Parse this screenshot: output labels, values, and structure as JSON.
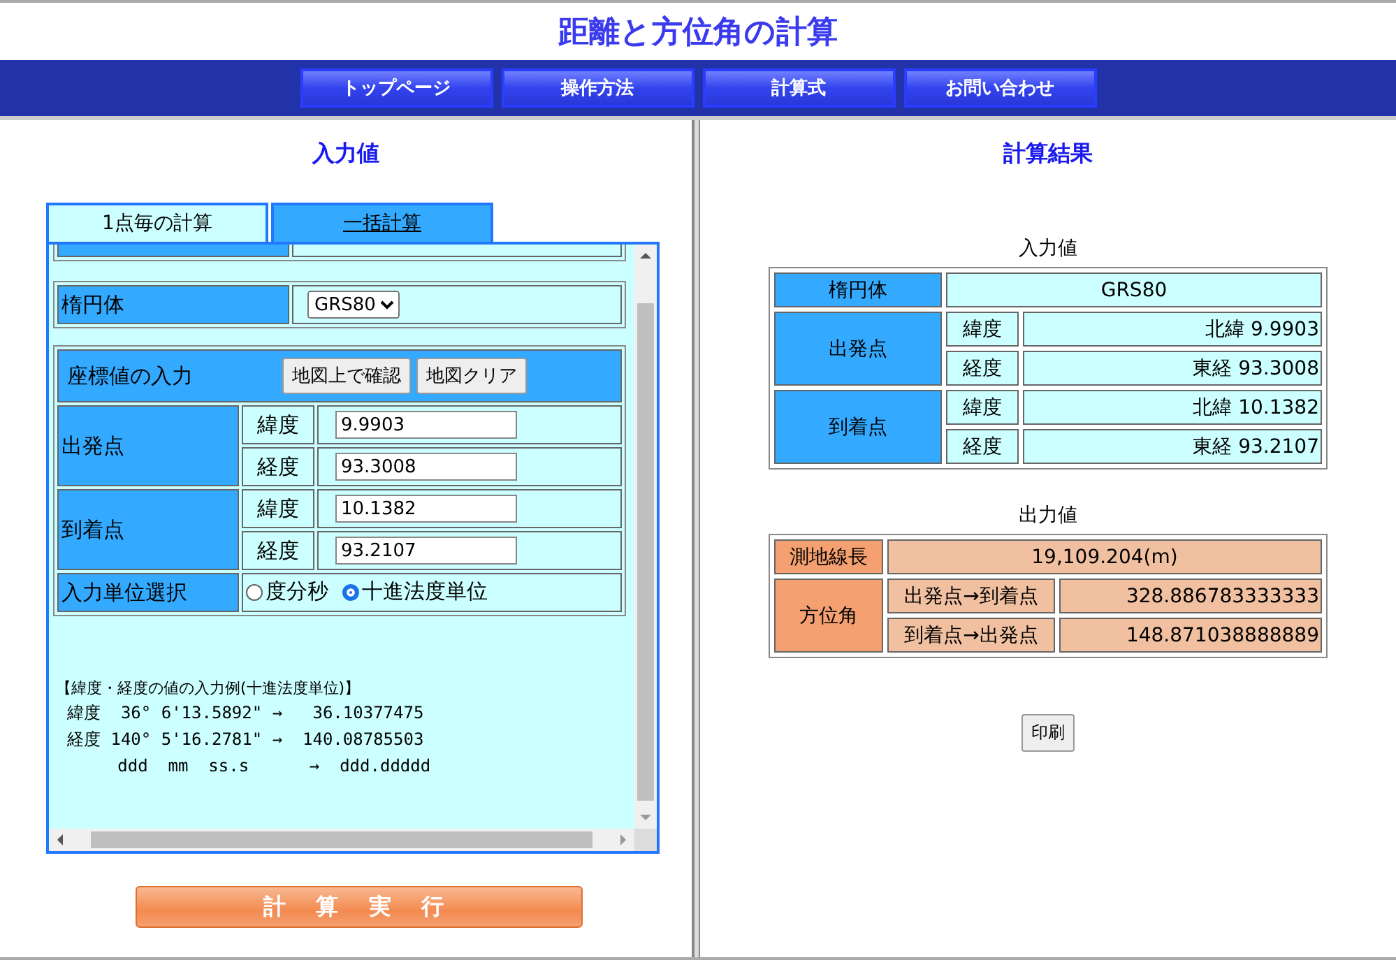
{
  "page_title": "距離と方位角の計算",
  "nav": [
    "トップページ",
    "操作方法",
    "計算式",
    "お問い合わせ"
  ],
  "input_panel": {
    "heading": "入力値",
    "tabs": [
      {
        "label": "1点毎の計算",
        "selected": true
      },
      {
        "label": "一括計算",
        "selected": false
      }
    ],
    "ellipsoid": {
      "label": "楕円体",
      "value": "GRS80"
    },
    "coords": {
      "label": "座標値の入力",
      "buttons": [
        "地図上で確認",
        "地図クリア"
      ],
      "points": [
        {
          "label": "出発点",
          "rows": [
            {
              "label": "緯度",
              "value": "9.9903"
            },
            {
              "label": "経度",
              "value": "93.3008"
            }
          ]
        },
        {
          "label": "到着点",
          "rows": [
            {
              "label": "緯度",
              "value": "10.1382"
            },
            {
              "label": "経度",
              "value": "93.2107"
            }
          ]
        }
      ]
    },
    "unit": {
      "label": "入力単位選択",
      "options": [
        {
          "label": "度分秒",
          "selected": false
        },
        {
          "label": "十進法度単位",
          "selected": true
        }
      ]
    },
    "example": {
      "title": "【緯度・経度の値の入力例(十進法度単位)】",
      "lines": [
        "緯度  36° 6'13.5892\" →   36.10377475",
        "経度 140° 5'16.2781\" →  140.08785503",
        "     ddd  mm  ss.s      →  ddd.ddddd"
      ]
    }
  },
  "execute_button": "計 算 実 行",
  "result_panel": {
    "heading": "計算結果",
    "input_caption": "入力値",
    "ellipsoid": {
      "label": "楕円体",
      "value": "GRS80"
    },
    "points": [
      {
        "label": "出発点",
        "rows": [
          {
            "label": "緯度",
            "value": "北緯 9.9903"
          },
          {
            "label": "経度",
            "value": "東経 93.3008"
          }
        ]
      },
      {
        "label": "到着点",
        "rows": [
          {
            "label": "緯度",
            "value": "北緯 10.1382"
          },
          {
            "label": "経度",
            "value": "東経 93.2107"
          }
        ]
      }
    ],
    "output_caption": "出力値",
    "distance": {
      "label": "測地線長",
      "value": "19,109.204(m)"
    },
    "azimuth": {
      "label": "方位角",
      "rows": [
        {
          "label": "出発点→到着点",
          "value": "328.886783333333"
        },
        {
          "label": "到着点→出発点",
          "value": "148.871038888889"
        }
      ]
    },
    "print_button": "印刷"
  }
}
